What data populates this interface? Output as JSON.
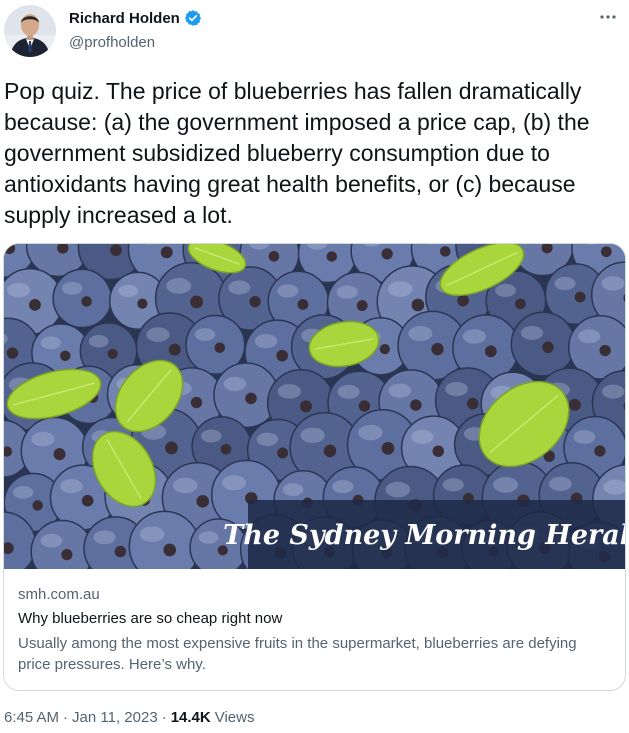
{
  "author": {
    "display_name": "Richard Holden",
    "handle": "@profholden",
    "verified": true,
    "avatar_icon": "profile-photo"
  },
  "tweet": {
    "text": "Pop quiz. The price of blueberries has fallen dramatically because: (a) the government imposed a price cap, (b) the government subsidized blueberry consumption due to antioxidants having great health benefits, or (c) because supply increased a lot."
  },
  "card": {
    "masthead": "The Sydney Morning Herald",
    "domain": "smh.com.au",
    "title": "Why blueberries are so cheap right now",
    "description": "Usually among the most expensive fruits in the supermarket, blueberries are defying price pressures. Here’s why."
  },
  "meta": {
    "time": "6:45 AM",
    "separator1": "·",
    "date": "Jan 11, 2023",
    "separator2": "·",
    "views_count": "14.4K",
    "views_label": "Views"
  },
  "colors": {
    "verified": "#1d9bf0",
    "secondary_text": "#536471",
    "primary_text": "#0f1419",
    "border": "#cfd9de"
  }
}
